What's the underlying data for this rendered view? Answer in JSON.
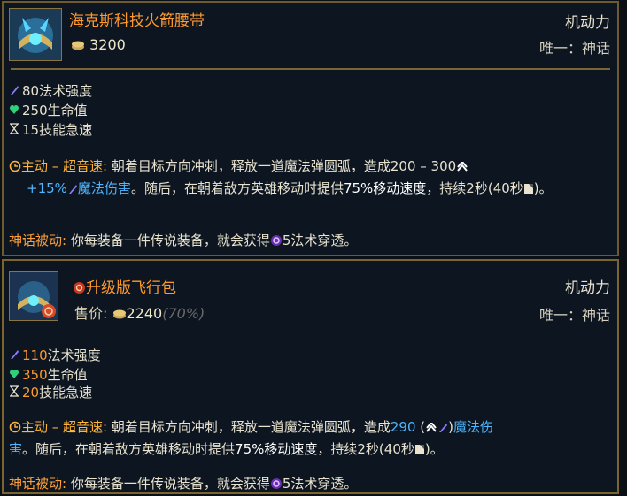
{
  "item1": {
    "name": "海克斯科技火箭腰带",
    "gold": "3200",
    "category": "机动力",
    "unique": "唯一：神话",
    "stats": [
      {
        "value": "80",
        "label": "法术强度"
      },
      {
        "value": "250",
        "label": "生命值"
      },
      {
        "value": "15",
        "label": "技能急速"
      }
    ],
    "active_label": "主动 – 超音速:",
    "active_text_1": "朝着目标方向冲刺，释放一道魔法弹圆弧，造成200 – 300",
    "active_scale": "+15%",
    "active_dmg": "魔法伤害",
    "active_text_2": "。随后，在朝着敌方英雄移动时提供",
    "active_ms": "75%移动速度",
    "active_text_3": "，持续2秒(40秒",
    "active_text_4": ")。",
    "mythic_label": "神话被动:",
    "mythic_text_1": "你每装备一件传说装备，就会获得",
    "mythic_text_2": "5法术穿透。"
  },
  "item2": {
    "name": "升级版飞行包",
    "sell_label": "售价:",
    "gold": "2240",
    "gold_pct": "(70%)",
    "category": "机动力",
    "unique": "唯一：神话",
    "stats": [
      {
        "value": "110",
        "label": "法术强度"
      },
      {
        "value": "350",
        "label": "生命值"
      },
      {
        "value": "20",
        "label": "技能急速"
      }
    ],
    "active_label": "主动 – 超音速:",
    "active_text_1": "朝着目标方向冲刺，释放一道魔法弹圆弧，造成",
    "active_base": "290",
    "active_dmg": "魔法伤",
    "active_dmg_2": "害",
    "active_text_2": "。随后，在朝着敌方英雄移动时提供",
    "active_ms": "75%移动速度",
    "active_text_3": "，持续2秒(40秒",
    "active_text_4": ")。",
    "mythic_label": "神话被动:",
    "mythic_text_1": "你每装备一件传说装备，就会获得",
    "mythic_text_2": "5法术穿透。"
  },
  "colors": {
    "name": "#ff9a2e",
    "active_label": "#ffb43a",
    "magic": "#4fb6ff",
    "upgraded_value": "#ff8a3a",
    "border": "#7a6634"
  }
}
